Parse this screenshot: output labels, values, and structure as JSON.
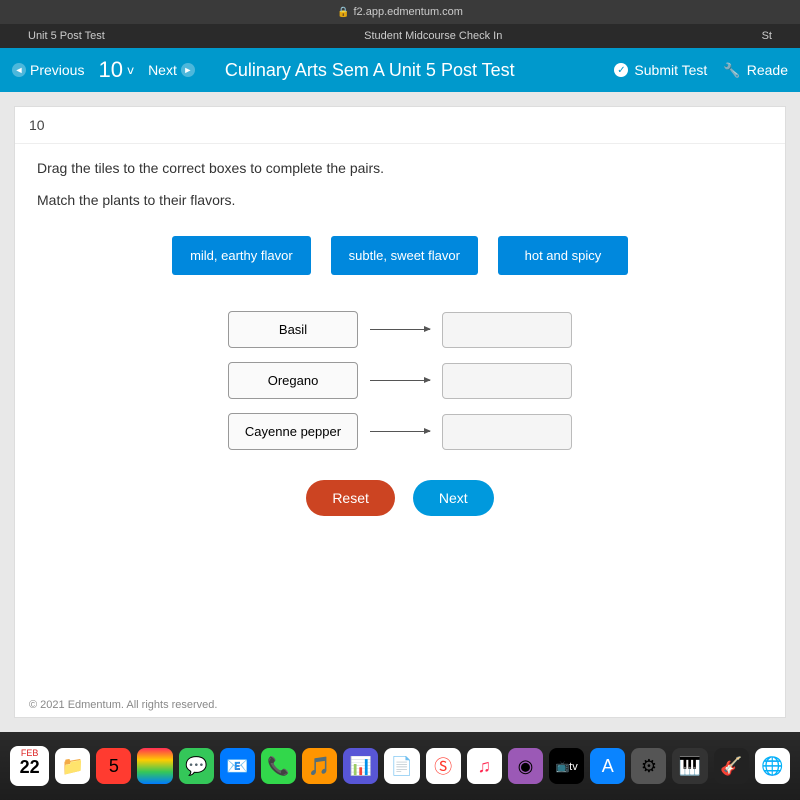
{
  "browser": {
    "url": "f2.app.edmentum.com"
  },
  "tabs": {
    "left": "Unit 5 Post Test",
    "center": "Student Midcourse Check In",
    "right": "St"
  },
  "nav": {
    "previous": "Previous",
    "qnum": "10",
    "next": "Next",
    "title": "Culinary Arts Sem A Unit 5 Post Test",
    "submit": "Submit Test",
    "reader": "Reade"
  },
  "question": {
    "number": "10",
    "instruction": "Drag the tiles to the correct boxes to complete the pairs.",
    "sub": "Match the plants to their flavors.",
    "tiles": [
      "mild, earthy flavor",
      "subtle, sweet flavor",
      "hot and spicy"
    ],
    "plants": [
      "Basil",
      "Oregano",
      "Cayenne pepper"
    ],
    "reset": "Reset",
    "nextbtn": "Next"
  },
  "footer": "© 2021 Edmentum. All rights reserved.",
  "calendar": {
    "month": "FEB",
    "day": "22"
  }
}
